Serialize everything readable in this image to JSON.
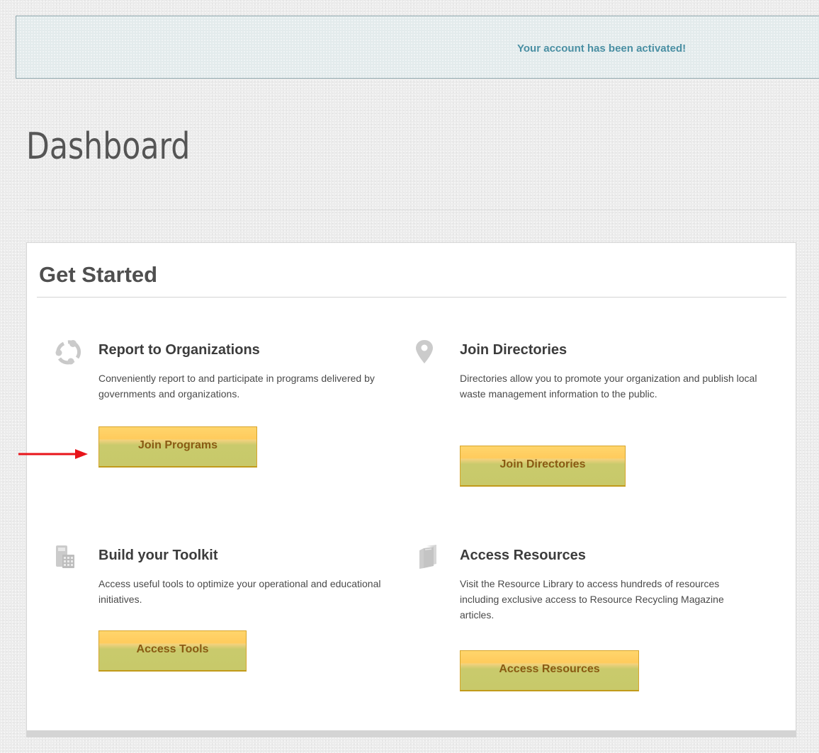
{
  "alert": {
    "message": "Your account has been activated!"
  },
  "page": {
    "title": "Dashboard"
  },
  "get_started": {
    "title": "Get Started",
    "sections": [
      {
        "title": "Report to Organizations",
        "description": "Conveniently report to and participate in programs delivered by governments and organizations.",
        "button_label": "Join Programs",
        "icon": "network-circle-icon"
      },
      {
        "title": "Join Directories",
        "description": "Directories allow you to promote your organization and publish local waste management information to the public.",
        "button_label": "Join Directories",
        "icon": "map-pin-icon"
      },
      {
        "title": "Build your Toolkit",
        "description": "Access useful tools to optimize your operational and educational initiatives.",
        "button_label": "Access Tools",
        "icon": "calculator-icon"
      },
      {
        "title": "Access Resources",
        "description": "Visit the Resource Library to access hundreds of resources including exclusive access to Resource Recycling Magazine articles.",
        "button_label": "Access Resources",
        "icon": "books-icon"
      }
    ]
  },
  "annotation": {
    "icon": "red-arrow-icon",
    "color": "#e8141a"
  },
  "colors": {
    "alert_text": "#4a8fa3",
    "button_label": "#8a5a12",
    "button_top": "#ffcb5c",
    "button_bottom": "#c8c96a"
  }
}
